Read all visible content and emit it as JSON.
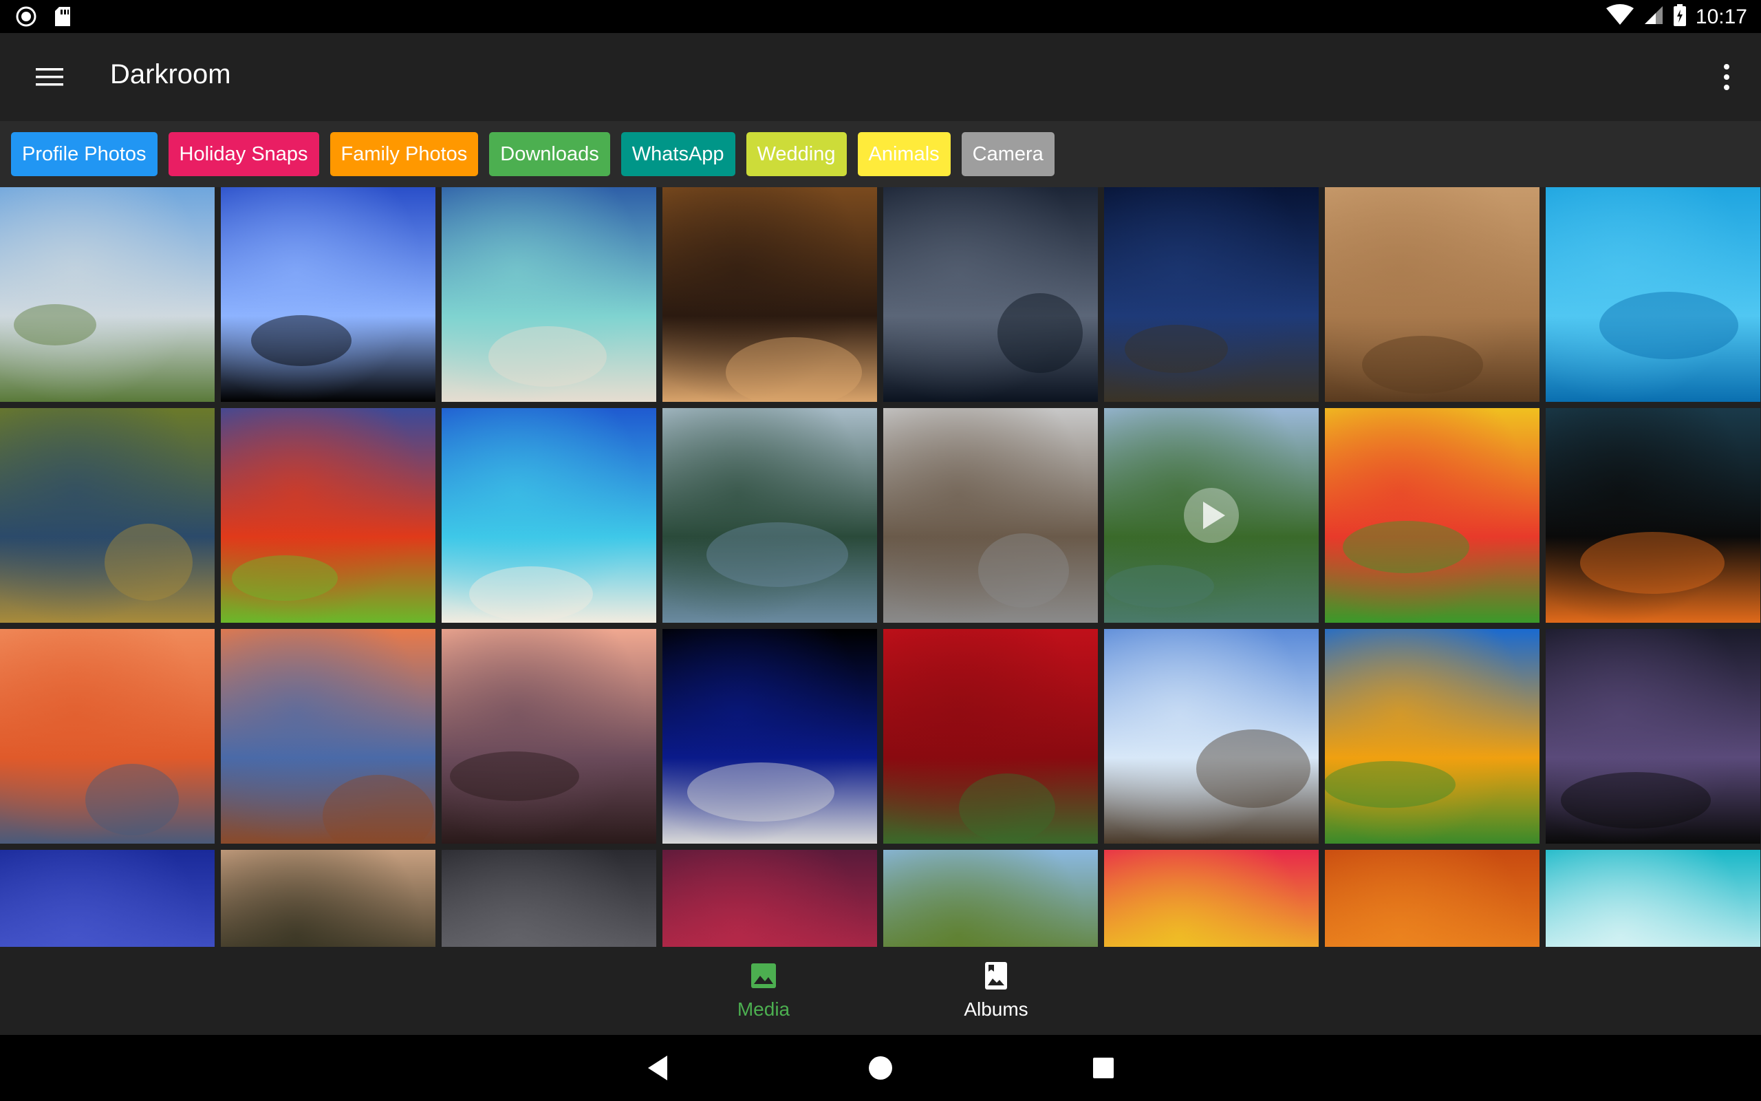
{
  "status_bar": {
    "time": "10:17",
    "icons_left": [
      "record-icon",
      "sd-card-icon"
    ],
    "icons_right": [
      "wifi-icon",
      "signal-icon",
      "battery-icon"
    ]
  },
  "app_bar": {
    "title": "Darkroom",
    "menu_icon": "hamburger-menu-icon",
    "overflow_icon": "more-vert-icon"
  },
  "albums": [
    {
      "label": "Profile Photos",
      "color": "#2196F3"
    },
    {
      "label": "Holiday Snaps",
      "color": "#E91E63"
    },
    {
      "label": "Family Photos",
      "color": "#FF9800"
    },
    {
      "label": "Downloads",
      "color": "#4CAF50"
    },
    {
      "label": "WhatsApp",
      "color": "#009688"
    },
    {
      "label": "Wedding",
      "color": "#CDDC39"
    },
    {
      "label": "Animals",
      "color": "#FFEB3B"
    },
    {
      "label": "Camera",
      "color": "#9E9E9E"
    }
  ],
  "media": [
    {
      "name": "eiffel-tower-photo",
      "colors": [
        "#6fa6dd",
        "#cfd9df",
        "#5a7a3a"
      ]
    },
    {
      "name": "silhouette-sky-photo",
      "colors": [
        "#2a4fc9",
        "#8db3ff",
        "#000000"
      ]
    },
    {
      "name": "tropical-beach-photo",
      "colors": [
        "#2e5fa8",
        "#7fd3d0",
        "#e6ddd0"
      ]
    },
    {
      "name": "chocolate-cake-photo",
      "colors": [
        "#7a4a1e",
        "#2b1a10",
        "#d9a36a"
      ]
    },
    {
      "name": "hot-air-balloon-photo",
      "colors": [
        "#1c2536",
        "#5b6678",
        "#0b1320"
      ]
    },
    {
      "name": "starry-night-photo",
      "colors": [
        "#071436",
        "#1e3a78",
        "#3a3326"
      ]
    },
    {
      "name": "leopard-photo",
      "colors": [
        "#c79a6b",
        "#a8794c",
        "#5a3b1f"
      ]
    },
    {
      "name": "dolphin-photo",
      "colors": [
        "#1fa5e0",
        "#50c7f2",
        "#0a6fb0"
      ]
    },
    {
      "name": "peacock-photo",
      "colors": [
        "#6b7a2a",
        "#2b4a6a",
        "#a88b3a"
      ]
    },
    {
      "name": "lorikeet-photo",
      "colors": [
        "#3a4a9a",
        "#e03a1a",
        "#6ab82a"
      ]
    },
    {
      "name": "turquoise-beach-photo",
      "colors": [
        "#1f5ad0",
        "#3ec8e8",
        "#f2ece0"
      ]
    },
    {
      "name": "mountain-lake-photo",
      "colors": [
        "#a8bcc8",
        "#2a4a3a",
        "#6a8aa0"
      ]
    },
    {
      "name": "hallstatt-village-photo",
      "colors": [
        "#c8c8c8",
        "#6a5a4a",
        "#8a8a8a"
      ]
    },
    {
      "name": "river-hills-video",
      "colors": [
        "#9ab8d8",
        "#3a6a2a",
        "#4a7a6a"
      ]
    },
    {
      "name": "butterfly-flowers-photo",
      "colors": [
        "#f0c020",
        "#e83a2a",
        "#3a9a2a"
      ]
    },
    {
      "name": "couple-silhouette-photo",
      "colors": [
        "#1a3a4a",
        "#0a0a0a",
        "#e06a1a"
      ]
    },
    {
      "name": "sunset-kayak-photo",
      "colors": [
        "#f08a5a",
        "#e05a2a",
        "#4a5a7a"
      ]
    },
    {
      "name": "wooden-pier-photo",
      "colors": [
        "#e87a4a",
        "#4a6aa8",
        "#8a4a2a"
      ]
    },
    {
      "name": "pier-sunset-photo",
      "colors": [
        "#f0a890",
        "#6a4a5a",
        "#2a1a1a"
      ]
    },
    {
      "name": "moon-photo",
      "colors": [
        "#000000",
        "#0a1a8a",
        "#d8d8d8"
      ]
    },
    {
      "name": "red-roses-photo",
      "colors": [
        "#c0101a",
        "#8a0a10",
        "#3a6a2a"
      ]
    },
    {
      "name": "hiker-cliff-photo",
      "colors": [
        "#5a8ad8",
        "#d8e8f8",
        "#4a3a2a"
      ]
    },
    {
      "name": "rainbow-lorikeet-photo",
      "colors": [
        "#1a6ad0",
        "#f0a010",
        "#3a8a2a"
      ]
    },
    {
      "name": "milky-way-photo",
      "colors": [
        "#1a1a2a",
        "#5a4a7a",
        "#0a0a0a"
      ]
    },
    {
      "name": "fire-sky-photo",
      "colors": [
        "#1a2a9a",
        "#4a5ad0",
        "#e07a3a"
      ]
    },
    {
      "name": "tiger-photo",
      "colors": [
        "#c8a080",
        "#2a2a1a",
        "#3a9a2a"
      ]
    },
    {
      "name": "night-person-photo",
      "colors": [
        "#2a2a30",
        "#6a6a70",
        "#0a0a0a"
      ]
    },
    {
      "name": "red-clouds-photo",
      "colors": [
        "#5a1a3a",
        "#c02a4a",
        "#1a0a2a"
      ]
    },
    {
      "name": "palm-tree-photo",
      "colors": [
        "#8ab8e0",
        "#5a7a1a",
        "#c8a040"
      ]
    },
    {
      "name": "tulips-photo",
      "colors": [
        "#e82a4a",
        "#f0d020",
        "#3a8a2a"
      ]
    },
    {
      "name": "autumn-tree-photo",
      "colors": [
        "#c84a10",
        "#f08a20",
        "#6a2a0a"
      ]
    },
    {
      "name": "ocean-wave-photo",
      "colors": [
        "#1ab8c8",
        "#e8f8f8",
        "#0a8a9a"
      ]
    }
  ],
  "bottom_nav": {
    "items": [
      {
        "label": "Media",
        "icon": "image-icon",
        "active": true,
        "color": "#4CAF50"
      },
      {
        "label": "Albums",
        "icon": "photo-album-icon",
        "active": false,
        "color": "#FFFFFF"
      }
    ]
  },
  "system_nav": [
    "back-icon",
    "home-icon",
    "recents-icon"
  ]
}
